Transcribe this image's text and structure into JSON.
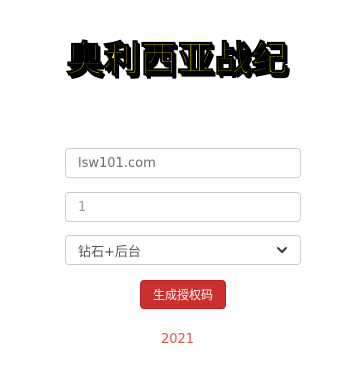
{
  "app": {
    "logo_text": "奥利西亚战纪"
  },
  "form": {
    "domain_value": "lsw101.com",
    "count_value": "1",
    "type_selected": "钻石+后台",
    "submit_label": "生成授权码"
  },
  "footer": {
    "year": "2021"
  },
  "colors": {
    "logo_fill": "#ffff00",
    "logo_outline": "#000000",
    "button_bg": "#cc2f2f",
    "year_text": "#d9534f"
  },
  "icons": {
    "select_arrow": "chevron-down-icon"
  }
}
